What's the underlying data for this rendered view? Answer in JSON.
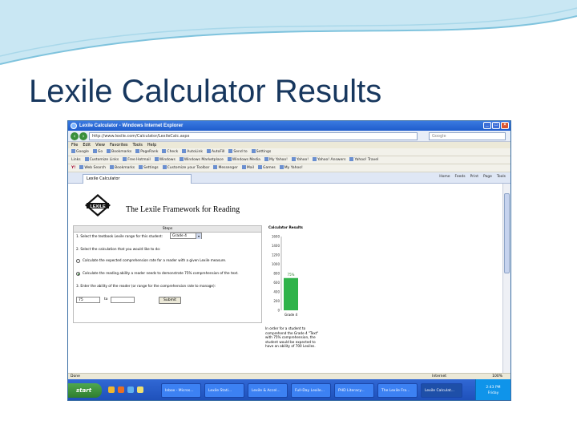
{
  "slide": {
    "title": "Lexile Calculator Results"
  },
  "browser": {
    "window_title": "Lexile Calculator - Windows Internet Explorer",
    "address": "http://www.lexile.com/Calculator/LexileCalc.aspx",
    "search_placeholder": "Google",
    "menu": [
      "File",
      "Edit",
      "View",
      "Favorites",
      "Tools",
      "Help"
    ],
    "toolbar1": [
      "Google",
      "Go",
      "Bookmarks",
      "PageRank",
      "Check",
      "AutoLink",
      "AutoFill",
      "Send to",
      "Settings"
    ],
    "toolbar2": [
      "Links",
      "Customize Links",
      "Free Hotmail",
      "Windows",
      "Windows Marketplace",
      "Windows Media",
      "My Yahoo!",
      "Yahoo!",
      "Yahoo! Answers",
      "Yahoo! Travel"
    ],
    "toolbar3": [
      "Web Search",
      "Bookmarks",
      "Settings",
      "Customize your Toolbar",
      "Messenger",
      "Mail",
      "Games",
      "My Yahoo!"
    ],
    "tab_label": "Lexile Calculator",
    "tab_tools": [
      "Home",
      "Feeds",
      "Print",
      "Page",
      "Tools"
    ],
    "status_text": "Done",
    "zone_text": "Internet",
    "zoom_text": "100%"
  },
  "page": {
    "framework_title": "The Lexile Framework for Reading",
    "logo_text": "LEXILE",
    "steps_header": "Steps",
    "step1": "1. Select the textbook Lexile range for this student:",
    "grade_value": "Grade 4",
    "step2": "2. Select the calculation that you would like to do:",
    "option1": "Calculate the expected comprehension rate for a reader with a given Lexile measure.",
    "option2": "Calculate the reading ability a reader needs to demonstrate 75% comprehension of the text.",
    "step3": "3. Enter the ability of the reader (or range for the comprehension rate to manage):",
    "from_value": "75",
    "to_label": "to",
    "to_value": "",
    "submit_label": "Submit",
    "results_header": "Calculator Results",
    "result_text": "In order for a student to comprehend the Grade 4 \"Text\" with 75% comprehension, the student would be expected to have an ability of 700 Lexiles."
  },
  "chart_data": {
    "type": "bar",
    "categories": [
      "Grade 4"
    ],
    "values": [
      700
    ],
    "bar_label": "75%",
    "ylim": [
      0,
      1600
    ],
    "yticks": [
      0,
      200,
      400,
      600,
      800,
      1000,
      1200,
      1400,
      1600
    ],
    "colors": {
      "bar": "#2fb34a"
    }
  },
  "taskbar": {
    "start_label": "start",
    "tasks": [
      "Inbox - Micros...",
      "Lexile Stati...",
      "Lexile & Accel...",
      "Full-Day Lexile...",
      "PHD Literacy...",
      "The Lexile Fra...",
      "Lexile Calculat..."
    ],
    "time": "2:43 PM",
    "day": "Friday"
  }
}
